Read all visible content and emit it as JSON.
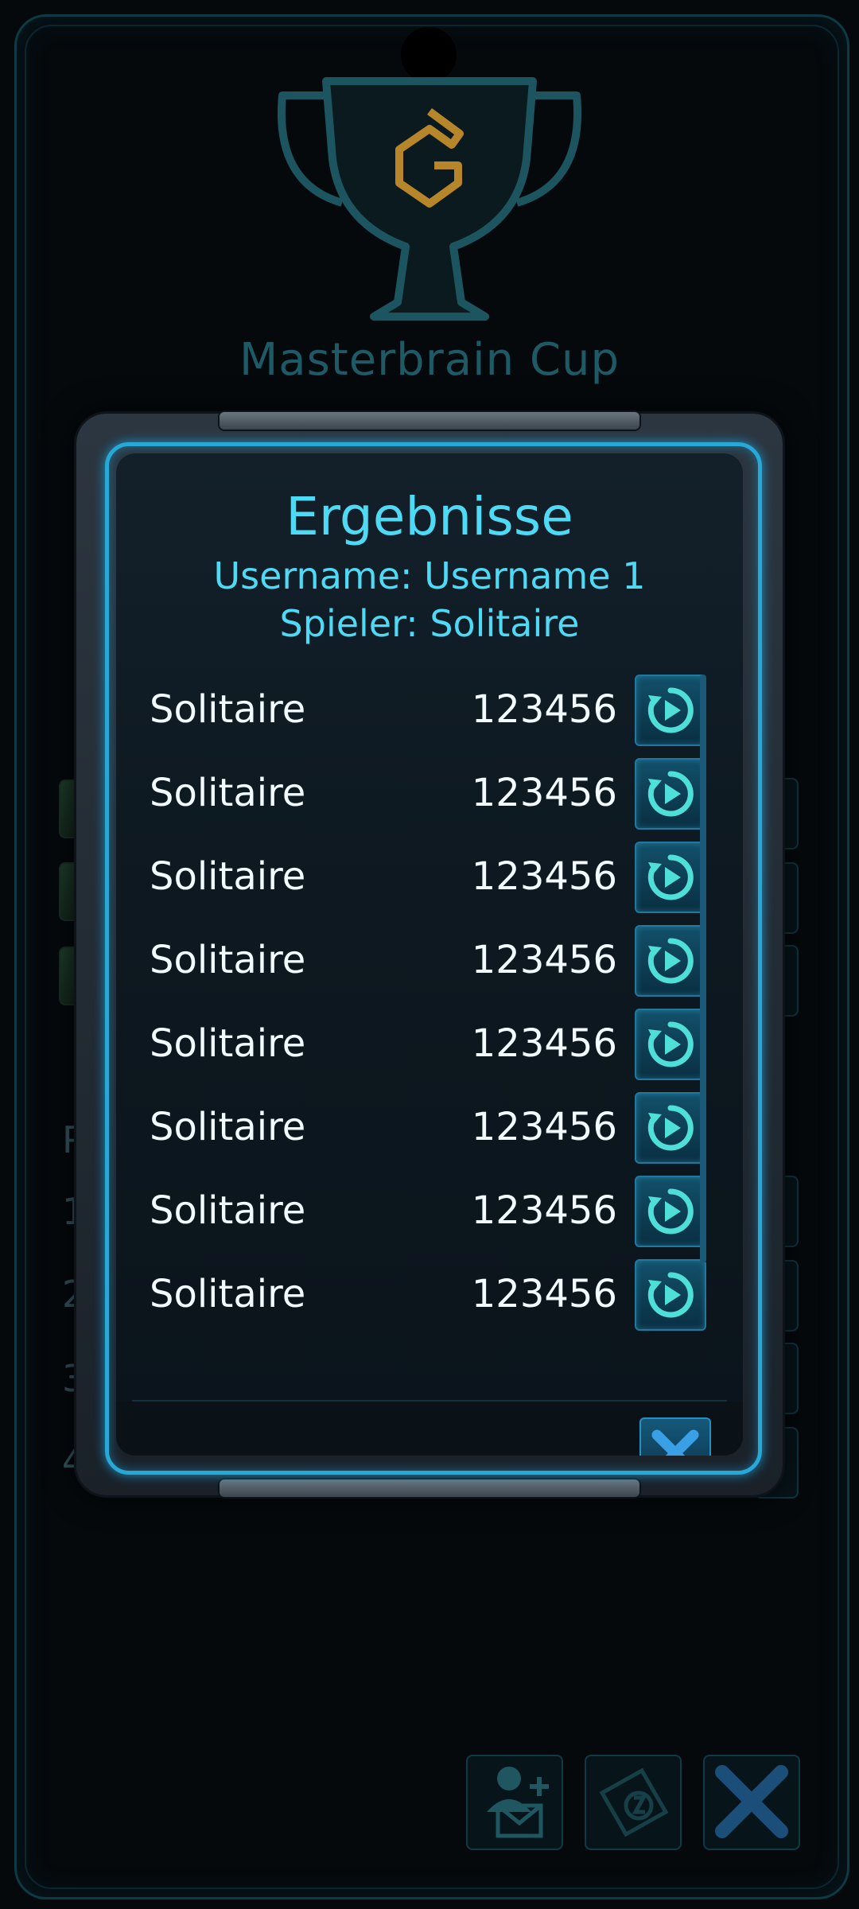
{
  "cup": {
    "title": "Masterbrain Cup"
  },
  "background": {
    "rank_header": "P",
    "ranks": [
      "1",
      "2",
      "3",
      "4"
    ]
  },
  "dialog": {
    "title": "Ergebnisse",
    "username_line": "Username: Username 1",
    "player_line": "Spieler: Solitaire",
    "rows": [
      {
        "name": "Solitaire",
        "score": "123456"
      },
      {
        "name": "Solitaire",
        "score": "123456"
      },
      {
        "name": "Solitaire",
        "score": "123456"
      },
      {
        "name": "Solitaire",
        "score": "123456"
      },
      {
        "name": "Solitaire",
        "score": "123456"
      },
      {
        "name": "Solitaire",
        "score": "123456"
      },
      {
        "name": "Solitaire",
        "score": "123456"
      },
      {
        "name": "Solitaire",
        "score": "123456"
      }
    ],
    "row_button_icon": "replay-icon",
    "close_icon": "close-icon"
  },
  "bottom_actions": [
    {
      "icon": "invite-friend-icon"
    },
    {
      "icon": "ticket-icon"
    },
    {
      "icon": "close-icon"
    }
  ],
  "colors": {
    "accent": "#4ed9f5",
    "frame_glow": "#27a8d6",
    "trophy_gold": "#b8862a",
    "button_blue": "#12506a"
  }
}
